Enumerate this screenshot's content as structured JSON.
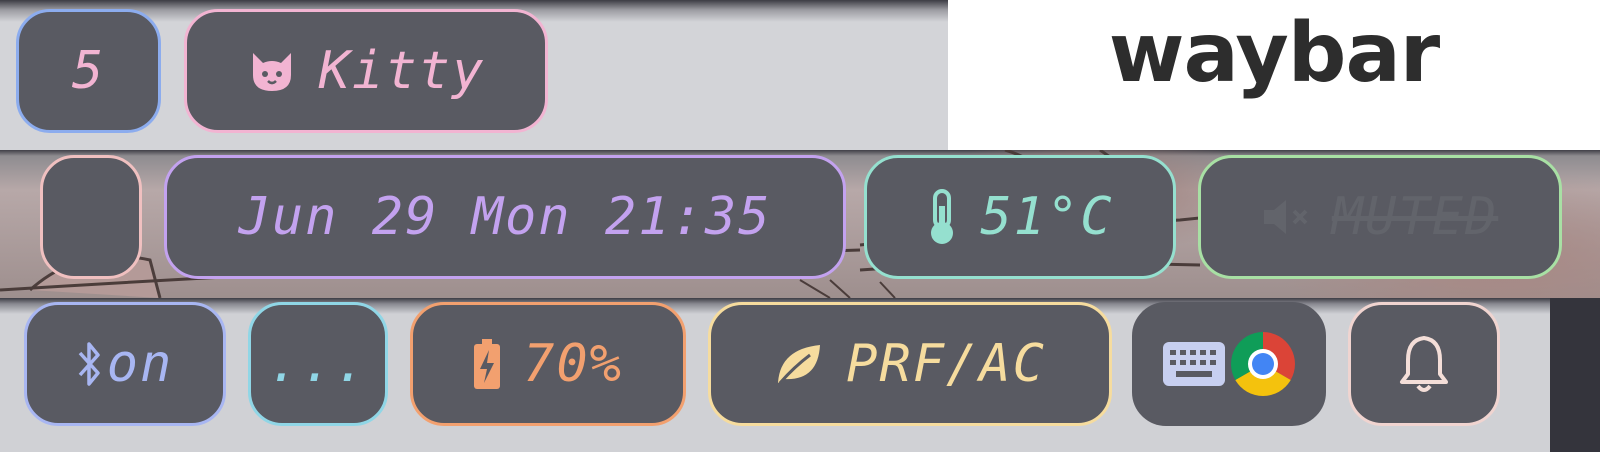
{
  "title": "waybar",
  "bar1": {
    "workspace": {
      "label": "5",
      "color": "#f2b4d2",
      "border": "#8cacee"
    },
    "window": {
      "icon": "cat-icon",
      "label": "Kitty",
      "color": "#f2b4d2",
      "border": "#f2b4d2"
    }
  },
  "bar2": {
    "empty_module": {
      "border": "#f0c0c0"
    },
    "clock": {
      "label": "Jun 29 Mon 21:35",
      "color": "#c3a2ef",
      "border": "#c3a2ef"
    },
    "temperature": {
      "icon": "thermometer-icon",
      "label": "51°C",
      "color": "#95e0cf",
      "border": "#95e0cf"
    },
    "audio": {
      "icon": "speaker-muted-icon",
      "label": "MUTED",
      "color": "#62646b",
      "border": "#a8e0a4"
    }
  },
  "bar3": {
    "bluetooth": {
      "icon": "bluetooth-icon",
      "label": "on",
      "color": "#a8b6f2",
      "border": "#a8b6f2"
    },
    "network": {
      "label": "...",
      "color": "#90d6e6",
      "border": "#90d6e6"
    },
    "battery": {
      "icon": "battery-charging-icon",
      "label": "70%",
      "color": "#f2a06f",
      "border": "#f2a06f"
    },
    "power_profile": {
      "icon": "leaf-icon",
      "label": "PRF/AC",
      "color": "#f6dc9e",
      "border": "#f6dc9e"
    },
    "tray": {
      "items": [
        "keyboard-icon",
        "chrome-icon"
      ]
    },
    "notifications": {
      "icon": "bell-icon",
      "color": "#f4ded8",
      "border": "#f0d4d0"
    }
  }
}
